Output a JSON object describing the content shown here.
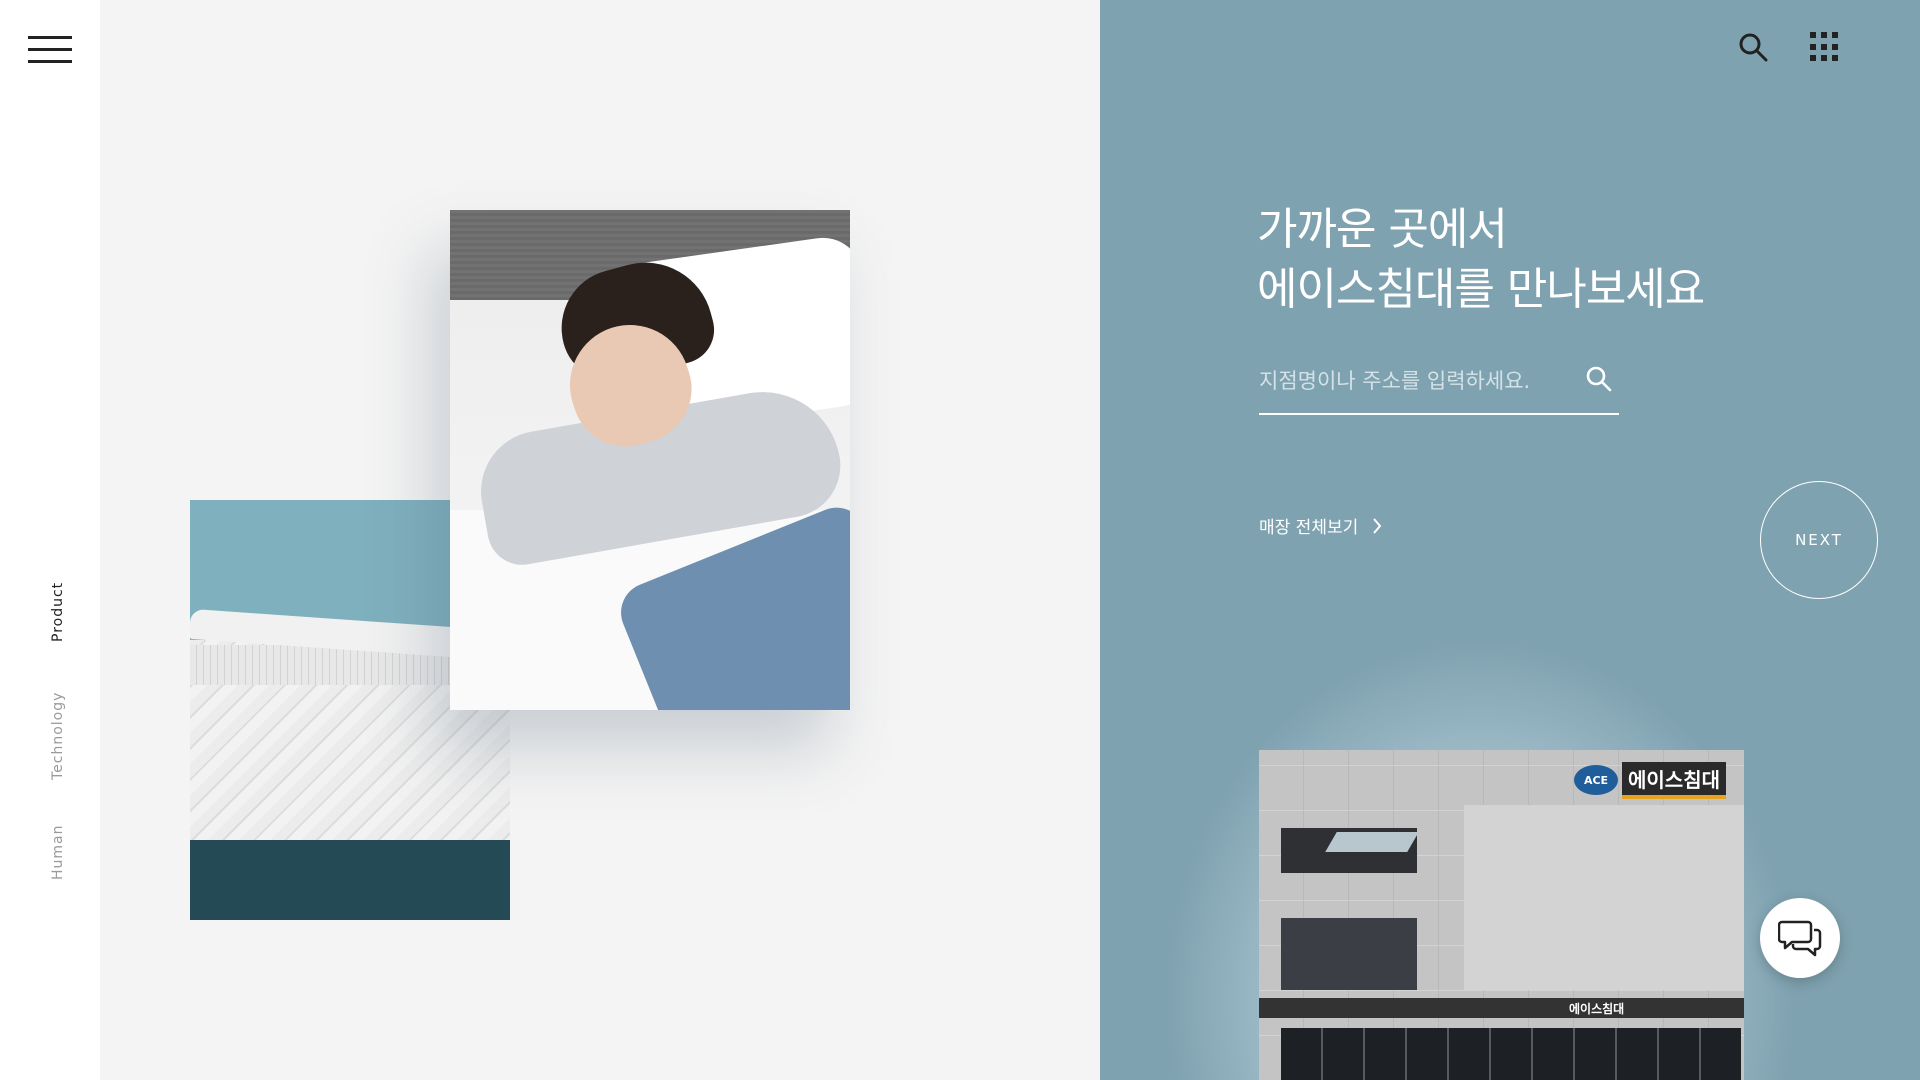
{
  "nav": {
    "menu_icon": "hamburger-menu-icon",
    "vertical_items": [
      {
        "label": "Product",
        "active": true
      },
      {
        "label": "Technology",
        "active": false
      },
      {
        "label": "Human",
        "active": false
      }
    ]
  },
  "header": {
    "search_icon": "search-icon",
    "apps_icon": "grid-apps-icon"
  },
  "store_finder": {
    "headline_line1": "가까운 곳에서",
    "headline_line2": "에이스침대를 만나보세요",
    "search_placeholder": "지점명이나 주소를 입력하세요.",
    "search_value": "",
    "view_all_label": "매장 전체보기",
    "next_label": "NEXT"
  },
  "storefront": {
    "logo_text": "ACE",
    "sign_text": "에이스침대",
    "bar_text": "에이스침대"
  },
  "chat": {
    "icon": "chat-bubbles-icon"
  },
  "colors": {
    "panel_blue": "#7fa2b0",
    "middle_bg": "#f4f4f4",
    "text_white": "#ffffff"
  }
}
